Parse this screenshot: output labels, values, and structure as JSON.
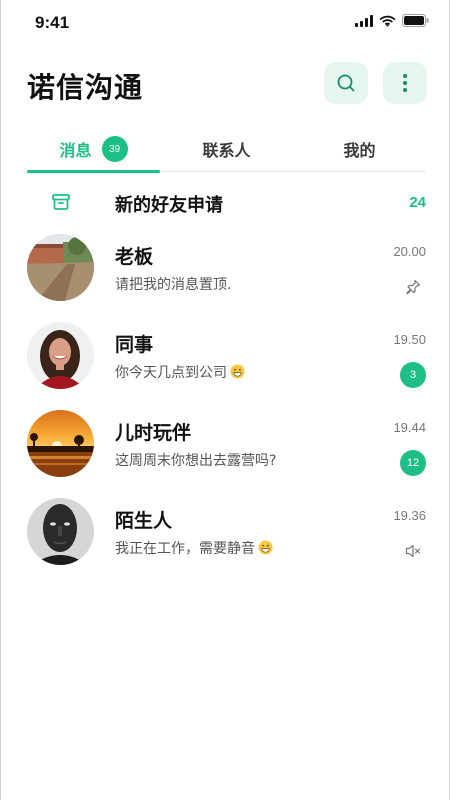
{
  "status_bar": {
    "time": "9:41",
    "icons": [
      "signal-icon",
      "wifi-icon",
      "battery-icon"
    ]
  },
  "header": {
    "title": "诺信沟通",
    "search_icon": "search-icon",
    "more_icon": "more-vertical-icon"
  },
  "tabs": [
    {
      "label": "消息",
      "badge": "39",
      "active": true
    },
    {
      "label": "联系人",
      "active": false
    },
    {
      "label": "我的",
      "active": false
    }
  ],
  "friend_request": {
    "icon": "archive-icon",
    "label": "新的好友申请",
    "count": "24"
  },
  "chats": [
    {
      "name": "老板",
      "preview": "请把我的消息置顶.",
      "time": "20.00",
      "status": "pin-icon"
    },
    {
      "name": "同事",
      "preview": "你今天几点到公司",
      "emoji": "grin-emoji",
      "time": "19.50",
      "unread": "3"
    },
    {
      "name": "儿时玩伴",
      "preview": "这周周末你想出去露营吗?",
      "time": "19.44",
      "unread": "12"
    },
    {
      "name": "陌生人",
      "preview": "我正在工作，需要静音",
      "emoji": "grin-emoji",
      "time": "19.36",
      "status": "muted-icon"
    }
  ],
  "colors": {
    "accent": "#1dbf84",
    "header_button_bg": "#e5f6ef"
  }
}
